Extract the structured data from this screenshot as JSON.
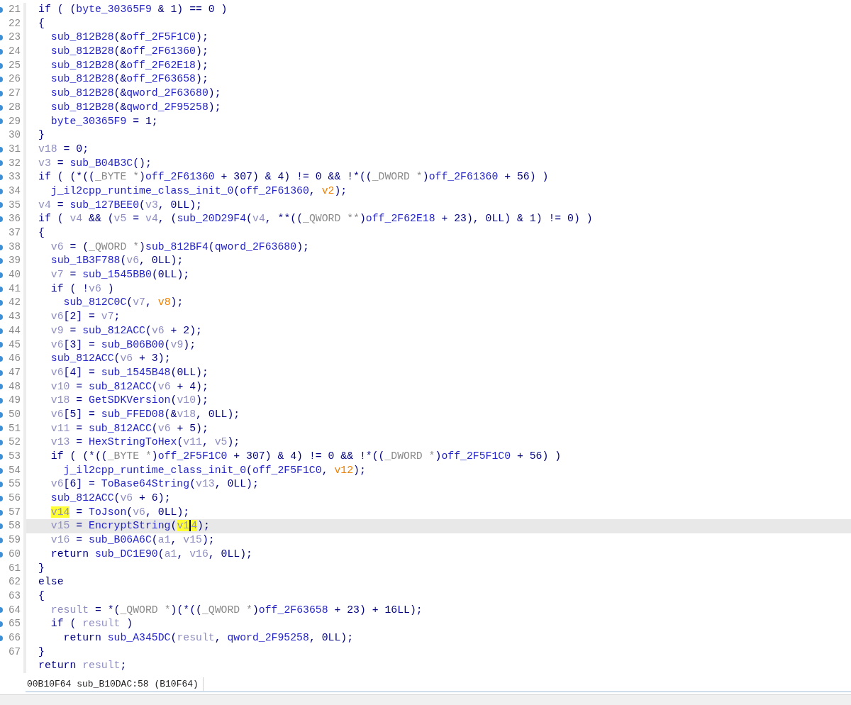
{
  "lines": [
    {
      "number": "21",
      "breakpoint": true,
      "current": false,
      "code": [
        {
          "text": "if ( (",
          "kind": "p"
        },
        {
          "text": "byte_30365F9",
          "kind": "n"
        },
        {
          "text": " & 1) == 0 )",
          "kind": "p"
        }
      ]
    },
    {
      "number": "22",
      "breakpoint": false,
      "current": false,
      "code": [
        {
          "text": "{",
          "kind": "p"
        }
      ]
    },
    {
      "number": "23",
      "breakpoint": true,
      "current": false,
      "code": [
        {
          "text": "  sub_812B28",
          "kind": "n"
        },
        {
          "text": "(&",
          "kind": "p"
        },
        {
          "text": "off_2F5F1C0",
          "kind": "n"
        },
        {
          "text": ");",
          "kind": "p"
        }
      ]
    },
    {
      "number": "24",
      "breakpoint": true,
      "current": false,
      "code": [
        {
          "text": "  sub_812B28",
          "kind": "n"
        },
        {
          "text": "(&",
          "kind": "p"
        },
        {
          "text": "off_2F61360",
          "kind": "n"
        },
        {
          "text": ");",
          "kind": "p"
        }
      ]
    },
    {
      "number": "25",
      "breakpoint": true,
      "current": false,
      "code": [
        {
          "text": "  sub_812B28",
          "kind": "n"
        },
        {
          "text": "(&",
          "kind": "p"
        },
        {
          "text": "off_2F62E18",
          "kind": "n"
        },
        {
          "text": ");",
          "kind": "p"
        }
      ]
    },
    {
      "number": "26",
      "breakpoint": true,
      "current": false,
      "code": [
        {
          "text": "  sub_812B28",
          "kind": "n"
        },
        {
          "text": "(&",
          "kind": "p"
        },
        {
          "text": "off_2F63658",
          "kind": "n"
        },
        {
          "text": ");",
          "kind": "p"
        }
      ]
    },
    {
      "number": "27",
      "breakpoint": true,
      "current": false,
      "code": [
        {
          "text": "  sub_812B28",
          "kind": "n"
        },
        {
          "text": "(&",
          "kind": "p"
        },
        {
          "text": "qword_2F63680",
          "kind": "n"
        },
        {
          "text": ");",
          "kind": "p"
        }
      ]
    },
    {
      "number": "28",
      "breakpoint": true,
      "current": false,
      "code": [
        {
          "text": "  sub_812B28",
          "kind": "n"
        },
        {
          "text": "(&",
          "kind": "p"
        },
        {
          "text": "qword_2F95258",
          "kind": "n"
        },
        {
          "text": ");",
          "kind": "p"
        }
      ]
    },
    {
      "number": "29",
      "breakpoint": true,
      "current": false,
      "code": [
        {
          "text": "  byte_30365F9",
          "kind": "n"
        },
        {
          "text": " = 1;",
          "kind": "p"
        }
      ]
    },
    {
      "number": "30",
      "breakpoint": false,
      "current": false,
      "code": [
        {
          "text": "}",
          "kind": "p"
        }
      ]
    },
    {
      "number": "31",
      "breakpoint": true,
      "current": false,
      "code": [
        {
          "text": "v18",
          "kind": "v"
        },
        {
          "text": " = 0;",
          "kind": "p"
        }
      ]
    },
    {
      "number": "32",
      "breakpoint": true,
      "current": false,
      "code": [
        {
          "text": "v3",
          "kind": "v"
        },
        {
          "text": " = ",
          "kind": "p"
        },
        {
          "text": "sub_B04B3C",
          "kind": "n"
        },
        {
          "text": "();",
          "kind": "p"
        }
      ]
    },
    {
      "number": "33",
      "breakpoint": true,
      "current": false,
      "code": [
        {
          "text": "if ( (*((",
          "kind": "p"
        },
        {
          "text": "_BYTE *",
          "kind": "t"
        },
        {
          "text": ")",
          "kind": "p"
        },
        {
          "text": "off_2F61360",
          "kind": "n"
        },
        {
          "text": " + 307) & 4) != 0 && !*((",
          "kind": "p"
        },
        {
          "text": "_DWORD *",
          "kind": "t"
        },
        {
          "text": ")",
          "kind": "p"
        },
        {
          "text": "off_2F61360",
          "kind": "n"
        },
        {
          "text": " + 56) )",
          "kind": "p"
        }
      ]
    },
    {
      "number": "34",
      "breakpoint": true,
      "current": false,
      "code": [
        {
          "text": "  j_il2cpp_runtime_class_init_0",
          "kind": "n"
        },
        {
          "text": "(",
          "kind": "p"
        },
        {
          "text": "off_2F61360",
          "kind": "n"
        },
        {
          "text": ", ",
          "kind": "p"
        },
        {
          "text": "v2",
          "kind": "u"
        },
        {
          "text": ");",
          "kind": "p"
        }
      ]
    },
    {
      "number": "35",
      "breakpoint": true,
      "current": false,
      "code": [
        {
          "text": "v4",
          "kind": "v"
        },
        {
          "text": " = ",
          "kind": "p"
        },
        {
          "text": "sub_127BEE0",
          "kind": "n"
        },
        {
          "text": "(",
          "kind": "p"
        },
        {
          "text": "v3",
          "kind": "v"
        },
        {
          "text": ", 0LL);",
          "kind": "p"
        }
      ]
    },
    {
      "number": "36",
      "breakpoint": true,
      "current": false,
      "code": [
        {
          "text": "if ( ",
          "kind": "p"
        },
        {
          "text": "v4",
          "kind": "v"
        },
        {
          "text": " && (",
          "kind": "p"
        },
        {
          "text": "v5",
          "kind": "v"
        },
        {
          "text": " = ",
          "kind": "p"
        },
        {
          "text": "v4",
          "kind": "v"
        },
        {
          "text": ", (",
          "kind": "p"
        },
        {
          "text": "sub_20D29F4",
          "kind": "n"
        },
        {
          "text": "(",
          "kind": "p"
        },
        {
          "text": "v4",
          "kind": "v"
        },
        {
          "text": ", **((",
          "kind": "p"
        },
        {
          "text": "_QWORD **",
          "kind": "t"
        },
        {
          "text": ")",
          "kind": "p"
        },
        {
          "text": "off_2F62E18",
          "kind": "n"
        },
        {
          "text": " + 23), 0LL) & 1) != 0) )",
          "kind": "p"
        }
      ]
    },
    {
      "number": "37",
      "breakpoint": false,
      "current": false,
      "code": [
        {
          "text": "{",
          "kind": "p"
        }
      ]
    },
    {
      "number": "38",
      "breakpoint": true,
      "current": false,
      "code": [
        {
          "text": "  v6",
          "kind": "v"
        },
        {
          "text": " = (",
          "kind": "p"
        },
        {
          "text": "_QWORD *",
          "kind": "t"
        },
        {
          "text": ")",
          "kind": "p"
        },
        {
          "text": "sub_812BF4",
          "kind": "n"
        },
        {
          "text": "(",
          "kind": "p"
        },
        {
          "text": "qword_2F63680",
          "kind": "n"
        },
        {
          "text": ");",
          "kind": "p"
        }
      ]
    },
    {
      "number": "39",
      "breakpoint": true,
      "current": false,
      "code": [
        {
          "text": "  sub_1B3F788",
          "kind": "n"
        },
        {
          "text": "(",
          "kind": "p"
        },
        {
          "text": "v6",
          "kind": "v"
        },
        {
          "text": ", 0LL);",
          "kind": "p"
        }
      ]
    },
    {
      "number": "40",
      "breakpoint": true,
      "current": false,
      "code": [
        {
          "text": "  v7",
          "kind": "v"
        },
        {
          "text": " = ",
          "kind": "p"
        },
        {
          "text": "sub_1545BB0",
          "kind": "n"
        },
        {
          "text": "(0LL);",
          "kind": "p"
        }
      ]
    },
    {
      "number": "41",
      "breakpoint": true,
      "current": false,
      "code": [
        {
          "text": "  if ( !",
          "kind": "p"
        },
        {
          "text": "v6",
          "kind": "v"
        },
        {
          "text": " )",
          "kind": "p"
        }
      ]
    },
    {
      "number": "42",
      "breakpoint": true,
      "current": false,
      "code": [
        {
          "text": "    sub_812C0C",
          "kind": "n"
        },
        {
          "text": "(",
          "kind": "p"
        },
        {
          "text": "v7",
          "kind": "v"
        },
        {
          "text": ", ",
          "kind": "p"
        },
        {
          "text": "v8",
          "kind": "u"
        },
        {
          "text": ");",
          "kind": "p"
        }
      ]
    },
    {
      "number": "43",
      "breakpoint": true,
      "current": false,
      "code": [
        {
          "text": "  v6",
          "kind": "v"
        },
        {
          "text": "[2] = ",
          "kind": "p"
        },
        {
          "text": "v7",
          "kind": "v"
        },
        {
          "text": ";",
          "kind": "p"
        }
      ]
    },
    {
      "number": "44",
      "breakpoint": true,
      "current": false,
      "code": [
        {
          "text": "  v9",
          "kind": "v"
        },
        {
          "text": " = ",
          "kind": "p"
        },
        {
          "text": "sub_812ACC",
          "kind": "n"
        },
        {
          "text": "(",
          "kind": "p"
        },
        {
          "text": "v6",
          "kind": "v"
        },
        {
          "text": " + 2);",
          "kind": "p"
        }
      ]
    },
    {
      "number": "45",
      "breakpoint": true,
      "current": false,
      "code": [
        {
          "text": "  v6",
          "kind": "v"
        },
        {
          "text": "[3] = ",
          "kind": "p"
        },
        {
          "text": "sub_B06B00",
          "kind": "n"
        },
        {
          "text": "(",
          "kind": "p"
        },
        {
          "text": "v9",
          "kind": "v"
        },
        {
          "text": ");",
          "kind": "p"
        }
      ]
    },
    {
      "number": "46",
      "breakpoint": true,
      "current": false,
      "code": [
        {
          "text": "  sub_812ACC",
          "kind": "n"
        },
        {
          "text": "(",
          "kind": "p"
        },
        {
          "text": "v6",
          "kind": "v"
        },
        {
          "text": " + 3);",
          "kind": "p"
        }
      ]
    },
    {
      "number": "47",
      "breakpoint": true,
      "current": false,
      "code": [
        {
          "text": "  v6",
          "kind": "v"
        },
        {
          "text": "[4] = ",
          "kind": "p"
        },
        {
          "text": "sub_1545B48",
          "kind": "n"
        },
        {
          "text": "(0LL);",
          "kind": "p"
        }
      ]
    },
    {
      "number": "48",
      "breakpoint": true,
      "current": false,
      "code": [
        {
          "text": "  v10",
          "kind": "v"
        },
        {
          "text": " = ",
          "kind": "p"
        },
        {
          "text": "sub_812ACC",
          "kind": "n"
        },
        {
          "text": "(",
          "kind": "p"
        },
        {
          "text": "v6",
          "kind": "v"
        },
        {
          "text": " + 4);",
          "kind": "p"
        }
      ]
    },
    {
      "number": "49",
      "breakpoint": true,
      "current": false,
      "code": [
        {
          "text": "  v18",
          "kind": "v"
        },
        {
          "text": " = ",
          "kind": "p"
        },
        {
          "text": "GetSDKVersion",
          "kind": "n"
        },
        {
          "text": "(",
          "kind": "p"
        },
        {
          "text": "v10",
          "kind": "v"
        },
        {
          "text": ");",
          "kind": "p"
        }
      ]
    },
    {
      "number": "50",
      "breakpoint": true,
      "current": false,
      "code": [
        {
          "text": "  v6",
          "kind": "v"
        },
        {
          "text": "[5] = ",
          "kind": "p"
        },
        {
          "text": "sub_FFED08",
          "kind": "n"
        },
        {
          "text": "(&",
          "kind": "p"
        },
        {
          "text": "v18",
          "kind": "v"
        },
        {
          "text": ", 0LL);",
          "kind": "p"
        }
      ]
    },
    {
      "number": "51",
      "breakpoint": true,
      "current": false,
      "code": [
        {
          "text": "  v11",
          "kind": "v"
        },
        {
          "text": " = ",
          "kind": "p"
        },
        {
          "text": "sub_812ACC",
          "kind": "n"
        },
        {
          "text": "(",
          "kind": "p"
        },
        {
          "text": "v6",
          "kind": "v"
        },
        {
          "text": " + 5);",
          "kind": "p"
        }
      ]
    },
    {
      "number": "52",
      "breakpoint": true,
      "current": false,
      "code": [
        {
          "text": "  v13",
          "kind": "v"
        },
        {
          "text": " = ",
          "kind": "p"
        },
        {
          "text": "HexStringToHex",
          "kind": "n"
        },
        {
          "text": "(",
          "kind": "p"
        },
        {
          "text": "v11",
          "kind": "v"
        },
        {
          "text": ", ",
          "kind": "p"
        },
        {
          "text": "v5",
          "kind": "v"
        },
        {
          "text": ");",
          "kind": "p"
        }
      ]
    },
    {
      "number": "53",
      "breakpoint": true,
      "current": false,
      "code": [
        {
          "text": "  if ( (*((",
          "kind": "p"
        },
        {
          "text": "_BYTE *",
          "kind": "t"
        },
        {
          "text": ")",
          "kind": "p"
        },
        {
          "text": "off_2F5F1C0",
          "kind": "n"
        },
        {
          "text": " + 307) & 4) != 0 && !*((",
          "kind": "p"
        },
        {
          "text": "_DWORD *",
          "kind": "t"
        },
        {
          "text": ")",
          "kind": "p"
        },
        {
          "text": "off_2F5F1C0",
          "kind": "n"
        },
        {
          "text": " + 56) )",
          "kind": "p"
        }
      ]
    },
    {
      "number": "54",
      "breakpoint": true,
      "current": false,
      "code": [
        {
          "text": "    j_il2cpp_runtime_class_init_0",
          "kind": "n"
        },
        {
          "text": "(",
          "kind": "p"
        },
        {
          "text": "off_2F5F1C0",
          "kind": "n"
        },
        {
          "text": ", ",
          "kind": "p"
        },
        {
          "text": "v12",
          "kind": "u"
        },
        {
          "text": ");",
          "kind": "p"
        }
      ]
    },
    {
      "number": "55",
      "breakpoint": true,
      "current": false,
      "code": [
        {
          "text": "  v6",
          "kind": "v"
        },
        {
          "text": "[6] = ",
          "kind": "p"
        },
        {
          "text": "ToBase64String",
          "kind": "n"
        },
        {
          "text": "(",
          "kind": "p"
        },
        {
          "text": "v13",
          "kind": "v"
        },
        {
          "text": ", 0LL);",
          "kind": "p"
        }
      ]
    },
    {
      "number": "56",
      "breakpoint": true,
      "current": false,
      "code": [
        {
          "text": "  sub_812ACC",
          "kind": "n"
        },
        {
          "text": "(",
          "kind": "p"
        },
        {
          "text": "v6",
          "kind": "v"
        },
        {
          "text": " + 6);",
          "kind": "p"
        }
      ]
    },
    {
      "number": "57",
      "breakpoint": true,
      "current": false,
      "code": [
        {
          "text": "  v14",
          "kind": "vh"
        },
        {
          "text": " = ",
          "kind": "p"
        },
        {
          "text": "ToJson",
          "kind": "n"
        },
        {
          "text": "(",
          "kind": "p"
        },
        {
          "text": "v6",
          "kind": "v"
        },
        {
          "text": ", 0LL);",
          "kind": "p"
        }
      ]
    },
    {
      "number": "58",
      "breakpoint": true,
      "current": true,
      "code": [
        {
          "text": "  v15",
          "kind": "v"
        },
        {
          "text": " = ",
          "kind": "p"
        },
        {
          "text": "EncryptString",
          "kind": "n"
        },
        {
          "text": "(",
          "kind": "p"
        },
        {
          "text": "v1",
          "kind": "vh"
        },
        {
          "text": "4",
          "kind": "vhc"
        },
        {
          "text": ");",
          "kind": "p"
        }
      ]
    },
    {
      "number": "59",
      "breakpoint": true,
      "current": false,
      "code": [
        {
          "text": "  v16",
          "kind": "v"
        },
        {
          "text": " = ",
          "kind": "p"
        },
        {
          "text": "sub_B06A6C",
          "kind": "n"
        },
        {
          "text": "(",
          "kind": "p"
        },
        {
          "text": "a1",
          "kind": "v"
        },
        {
          "text": ", ",
          "kind": "p"
        },
        {
          "text": "v15",
          "kind": "v"
        },
        {
          "text": ");",
          "kind": "p"
        }
      ]
    },
    {
      "number": "60",
      "breakpoint": true,
      "current": false,
      "code": [
        {
          "text": "  return ",
          "kind": "p"
        },
        {
          "text": "sub_DC1E90",
          "kind": "n"
        },
        {
          "text": "(",
          "kind": "p"
        },
        {
          "text": "a1",
          "kind": "v"
        },
        {
          "text": ", ",
          "kind": "p"
        },
        {
          "text": "v16",
          "kind": "v"
        },
        {
          "text": ", 0LL);",
          "kind": "p"
        }
      ]
    },
    {
      "number": "61",
      "breakpoint": false,
      "current": false,
      "code": [
        {
          "text": "}",
          "kind": "p"
        }
      ]
    },
    {
      "number": "62",
      "breakpoint": false,
      "current": false,
      "code": [
        {
          "text": "else",
          "kind": "p"
        }
      ]
    },
    {
      "number": "63",
      "breakpoint": false,
      "current": false,
      "code": [
        {
          "text": "{",
          "kind": "p"
        }
      ]
    },
    {
      "number": "64",
      "breakpoint": true,
      "current": false,
      "code": [
        {
          "text": "  result",
          "kind": "v"
        },
        {
          "text": " = *(",
          "kind": "p"
        },
        {
          "text": "_QWORD *",
          "kind": "t"
        },
        {
          "text": ")(*((",
          "kind": "p"
        },
        {
          "text": "_QWORD *",
          "kind": "t"
        },
        {
          "text": ")",
          "kind": "p"
        },
        {
          "text": "off_2F63658",
          "kind": "n"
        },
        {
          "text": " + 23) + 16LL);",
          "kind": "p"
        }
      ]
    },
    {
      "number": "65",
      "breakpoint": true,
      "current": false,
      "code": [
        {
          "text": "  if ( ",
          "kind": "p"
        },
        {
          "text": "result",
          "kind": "v"
        },
        {
          "text": " )",
          "kind": "p"
        }
      ]
    },
    {
      "number": "66",
      "breakpoint": true,
      "current": false,
      "code": [
        {
          "text": "    return ",
          "kind": "p"
        },
        {
          "text": "sub_A345DC",
          "kind": "n"
        },
        {
          "text": "(",
          "kind": "p"
        },
        {
          "text": "result",
          "kind": "v"
        },
        {
          "text": ", ",
          "kind": "p"
        },
        {
          "text": "qword_2F95258",
          "kind": "n"
        },
        {
          "text": ", 0LL);",
          "kind": "p"
        }
      ]
    },
    {
      "number": "67",
      "breakpoint": false,
      "current": false,
      "code": [
        {
          "text": "}",
          "kind": "p"
        }
      ]
    },
    {
      "breakpoint": false,
      "current": false,
      "code": [
        {
          "text": "return ",
          "kind": "p"
        },
        {
          "text": "result",
          "kind": "v"
        },
        {
          "text": ";",
          "kind": "p"
        }
      ]
    }
  ],
  "status_bar": {
    "location": "00B10F64 sub_B10DAC:58 (B10F64)"
  }
}
